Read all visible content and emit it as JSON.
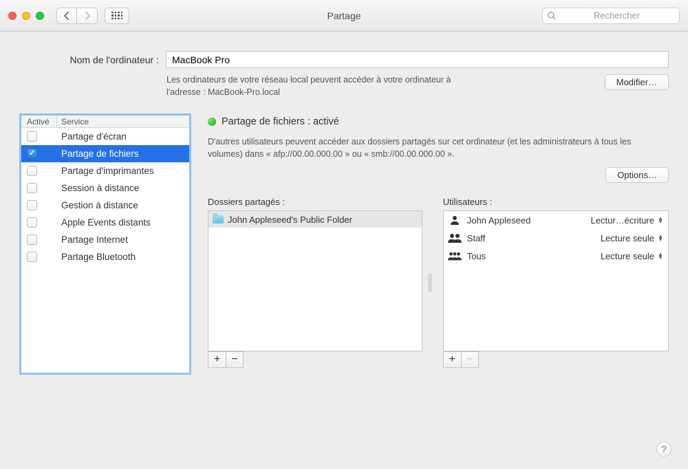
{
  "window": {
    "title": "Partage",
    "search_placeholder": "Rechercher"
  },
  "header": {
    "name_label": "Nom de l'ordinateur :",
    "name_value": "MacBook Pro",
    "sub_text": "Les ordinateurs de votre réseau local peuvent accéder à votre ordinateur à l'adresse : MacBook-Pro.local",
    "modifier_label": "Modifier…"
  },
  "services": {
    "header_active": "Activé",
    "header_service": "Service",
    "items": [
      {
        "label": "Partage d'écran",
        "checked": false,
        "selected": false
      },
      {
        "label": "Partage de fichiers",
        "checked": true,
        "selected": true
      },
      {
        "label": "Partage d'imprimantes",
        "checked": false,
        "selected": false
      },
      {
        "label": "Session à distance",
        "checked": false,
        "selected": false
      },
      {
        "label": "Gestion à distance",
        "checked": false,
        "selected": false
      },
      {
        "label": "Apple Events distants",
        "checked": false,
        "selected": false
      },
      {
        "label": "Partage Internet",
        "checked": false,
        "selected": false
      },
      {
        "label": "Partage Bluetooth",
        "checked": false,
        "selected": false
      }
    ]
  },
  "detail": {
    "status_title": "Partage de fichiers : activé",
    "status_text": "D'autres utilisateurs peuvent accéder aux dossiers partagés sur cet ordinateur (et les administrateurs à tous les volumes) dans « afp://00.00.000.00 » ou « smb://00.00.000.00 ».",
    "options_label": "Options…",
    "folders_title": "Dossiers partagés :",
    "users_title": "Utilisateurs :",
    "folders": [
      {
        "label": "John Appleseed's Public Folder"
      }
    ],
    "users": [
      {
        "icon": "single",
        "name": "John Appleseed",
        "perm": "Lectur…écriture"
      },
      {
        "icon": "pair",
        "name": "Staff",
        "perm": "Lecture seule"
      },
      {
        "icon": "group",
        "name": "Tous",
        "perm": "Lecture seule"
      }
    ]
  },
  "colors": {
    "focus_ring": "#8fbff0",
    "selection": "#2471e7",
    "status_green": "#1fa81f"
  }
}
